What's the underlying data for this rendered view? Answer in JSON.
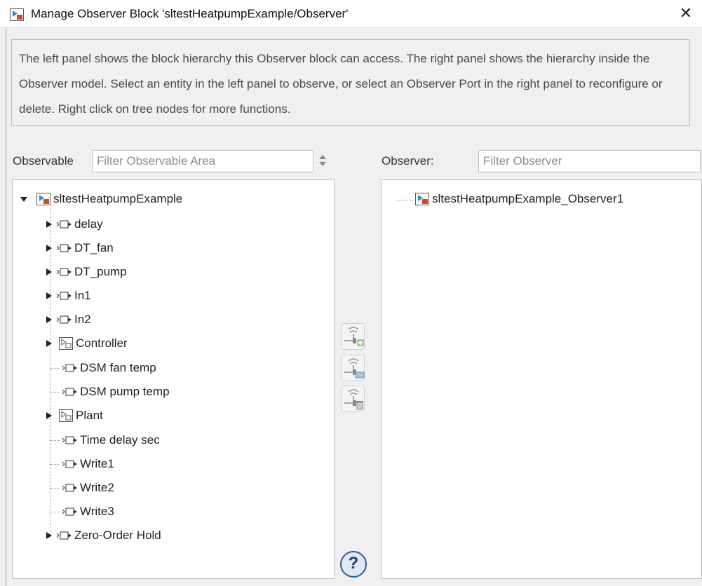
{
  "window": {
    "title": "Manage Observer Block 'sltestHeatpumpExample/Observer'",
    "close_glyph": "✕"
  },
  "description": "The left panel shows the block hierarchy this Observer block can access. The right panel shows the hierarchy inside the Observer model. Select an entity in the left panel to observe, or select an Observer Port in the right panel to reconfigure or delete. Right click on tree nodes for more functions.",
  "observable": {
    "label": "Observable",
    "filter_placeholder": "Filter Observable Area",
    "filter_value": "",
    "tree": {
      "root": {
        "label": "sltestHeatpumpExample",
        "expanded": true,
        "icon": "model-icon"
      },
      "children": [
        {
          "label": "delay",
          "icon": "port-icon",
          "expandable": true
        },
        {
          "label": "DT_fan",
          "icon": "port-icon",
          "expandable": true
        },
        {
          "label": "DT_pump",
          "icon": "port-icon",
          "expandable": true
        },
        {
          "label": "In1",
          "icon": "port-icon",
          "expandable": true
        },
        {
          "label": "In2",
          "icon": "port-icon",
          "expandable": true
        },
        {
          "label": "Controller",
          "icon": "subsystem-icon",
          "expandable": true
        },
        {
          "label": "DSM fan temp",
          "icon": "port-icon",
          "expandable": false
        },
        {
          "label": "DSM pump temp",
          "icon": "port-icon",
          "expandable": false
        },
        {
          "label": "Plant",
          "icon": "subsystem-icon",
          "expandable": true
        },
        {
          "label": "Time delay sec",
          "icon": "port-icon",
          "expandable": false
        },
        {
          "label": "Write1",
          "icon": "port-icon",
          "expandable": false
        },
        {
          "label": "Write2",
          "icon": "port-icon",
          "expandable": false
        },
        {
          "label": "Write3",
          "icon": "port-icon",
          "expandable": false
        },
        {
          "label": "Zero-Order Hold",
          "icon": "port-icon",
          "expandable": true
        }
      ]
    }
  },
  "observer": {
    "label": "Observer:",
    "filter_placeholder": "Filter Observer",
    "filter_value": "",
    "tree": {
      "root": {
        "label": "sltestHeatpumpExample_Observer1",
        "icon": "model-icon"
      }
    }
  },
  "actions": {
    "add_icon": "add-observer-port-icon",
    "reconfigure_icon": "reconfigure-observer-port-icon",
    "delete_icon": "delete-observer-port-icon",
    "help_glyph": "?"
  },
  "colors": {
    "accent": "#2d5c94",
    "panel_bg": "#ffffff",
    "window_bg": "#f0f0f0"
  }
}
